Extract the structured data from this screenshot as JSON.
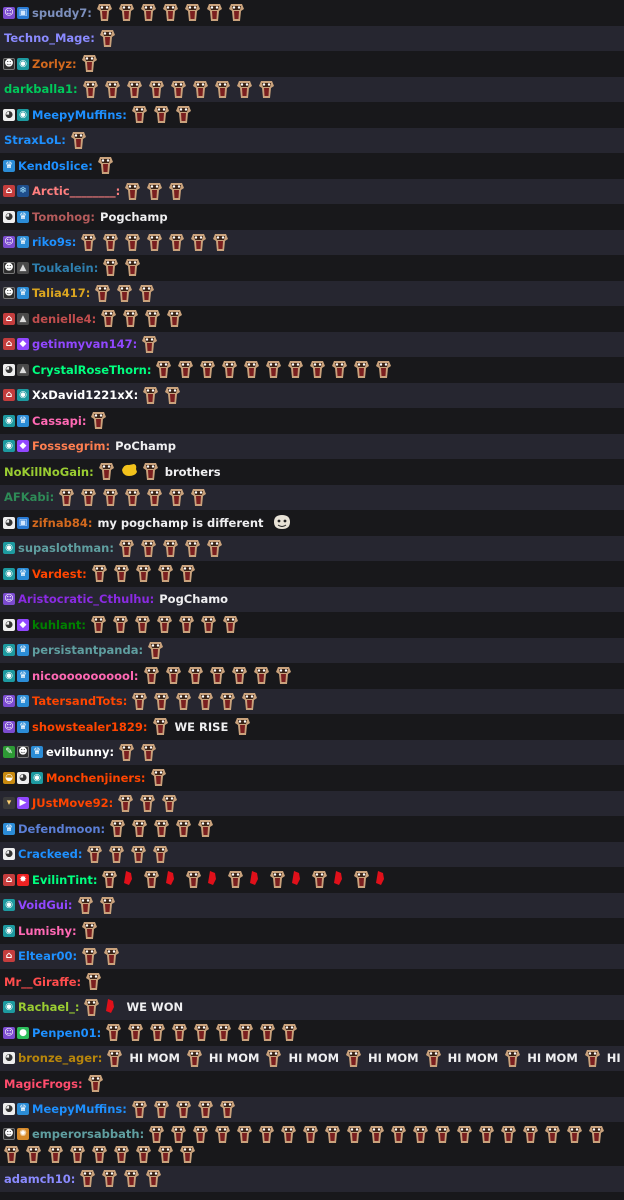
{
  "chat": [
    {
      "badges": [
        "sub",
        "gift"
      ],
      "user": "spuddy7",
      "color": "#7c8fbd",
      "parts": [
        {
          "e": "pog",
          "n": 7
        }
      ]
    },
    {
      "badges": [],
      "user": "Techno_Mage",
      "color": "#8a8aff",
      "parts": [
        {
          "e": "pog",
          "n": 1
        }
      ]
    },
    {
      "badges": [
        "mod",
        "teal"
      ],
      "user": "Zorlyz",
      "color": "#d2691e",
      "parts": [
        {
          "e": "pog",
          "n": 1
        }
      ]
    },
    {
      "badges": [],
      "user": "darkballa1",
      "color": "#00c85a",
      "parts": [
        {
          "e": "pog",
          "n": 9
        }
      ]
    },
    {
      "badges": [
        "cow",
        "teal"
      ],
      "user": "MeepyMuffins",
      "color": "#1e90ff",
      "parts": [
        {
          "e": "pog",
          "n": 3
        }
      ]
    },
    {
      "badges": [],
      "user": "StraxLoL",
      "color": "#1e90ff",
      "parts": [
        {
          "e": "pog",
          "n": 1
        }
      ]
    },
    {
      "badges": [
        "crown"
      ],
      "user": "Kend0slice",
      "color": "#1e90ff",
      "parts": [
        {
          "e": "pog",
          "n": 1
        }
      ]
    },
    {
      "badges": [
        "house",
        "snow"
      ],
      "user": "Arctic________",
      "color": "#ff7f7f",
      "parts": [
        {
          "e": "pog",
          "n": 3
        }
      ]
    },
    {
      "badges": [
        "cow",
        "crown"
      ],
      "user": "Tomohog",
      "color": "#b45b5b",
      "parts": [
        {
          "t": "Pogchamp"
        }
      ]
    },
    {
      "badges": [
        "sub",
        "crown"
      ],
      "user": "riko9s",
      "color": "#1e90ff",
      "parts": [
        {
          "e": "pog",
          "n": 7
        }
      ]
    },
    {
      "badges": [
        "mod",
        "tri"
      ],
      "user": "Toukalein",
      "color": "#2e7fae",
      "parts": [
        {
          "e": "pog",
          "n": 2
        }
      ]
    },
    {
      "badges": [
        "mod",
        "crown"
      ],
      "user": "Talia417",
      "color": "#daa520",
      "parts": [
        {
          "e": "pog",
          "n": 3
        }
      ]
    },
    {
      "badges": [
        "house",
        "tri"
      ],
      "user": "denielle4",
      "color": "#c04d4d",
      "parts": [
        {
          "e": "pog",
          "n": 4
        }
      ]
    },
    {
      "badges": [
        "house",
        "gem"
      ],
      "user": "getinmyvan147",
      "color": "#9147ff",
      "parts": [
        {
          "e": "pog",
          "n": 1
        }
      ]
    },
    {
      "badges": [
        "cow",
        "tri"
      ],
      "user": "CrystalRoseThorn",
      "color": "#00ff7f",
      "parts": [
        {
          "e": "pog",
          "n": 11
        }
      ]
    },
    {
      "badges": [
        "house",
        "teal"
      ],
      "user": "XxDavid1221xX",
      "color": "#ffffff",
      "parts": [
        {
          "e": "pog",
          "n": 2
        }
      ]
    },
    {
      "badges": [
        "teal",
        "crown"
      ],
      "user": "Cassapi",
      "color": "#ff69b4",
      "parts": [
        {
          "e": "pog",
          "n": 1
        }
      ]
    },
    {
      "badges": [
        "teal",
        "gem"
      ],
      "user": "Fosssegrim",
      "color": "#ff7f50",
      "parts": [
        {
          "t": "PoChamp"
        }
      ]
    },
    {
      "badges": [],
      "user": "NoKillNoGain",
      "color": "#9acd32",
      "parts": [
        {
          "e": "pog",
          "n": 1
        },
        {
          "e": "hand",
          "n": 1
        },
        {
          "e": "pog",
          "n": 1
        },
        {
          "t": "brothers"
        }
      ]
    },
    {
      "badges": [],
      "user": "AFKabi",
      "color": "#2e8b57",
      "parts": [
        {
          "e": "pog",
          "n": 7
        }
      ]
    },
    {
      "badges": [
        "cow",
        "gift"
      ],
      "user": "zifnab84",
      "color": "#d2691e",
      "parts": [
        {
          "t": "my pogchamp is different"
        },
        {
          "e": "face",
          "n": 1
        }
      ]
    },
    {
      "badges": [
        "teal"
      ],
      "user": "supaslothman",
      "color": "#5f9ea0",
      "parts": [
        {
          "e": "pog",
          "n": 5
        }
      ]
    },
    {
      "badges": [
        "teal",
        "crown"
      ],
      "user": "Vardest",
      "color": "#ff4500",
      "parts": [
        {
          "e": "pog",
          "n": 5
        }
      ]
    },
    {
      "badges": [
        "sub"
      ],
      "user": "Aristocratic_Cthulhu",
      "color": "#8a2be2",
      "parts": [
        {
          "t": "PogChamo"
        }
      ]
    },
    {
      "badges": [
        "cow",
        "gem"
      ],
      "user": "kuhlant",
      "color": "#008000",
      "parts": [
        {
          "e": "pog",
          "n": 7
        }
      ]
    },
    {
      "badges": [
        "teal",
        "crown"
      ],
      "user": "persistantpanda",
      "color": "#5f9ea0",
      "parts": [
        {
          "e": "pog",
          "n": 1
        }
      ]
    },
    {
      "badges": [
        "teal",
        "crown"
      ],
      "user": "nicooooooooool",
      "color": "#ff69b4",
      "parts": [
        {
          "e": "pog",
          "n": 7
        }
      ]
    },
    {
      "badges": [
        "sub",
        "crown"
      ],
      "user": "TatersandTots",
      "color": "#ff4500",
      "parts": [
        {
          "e": "pog",
          "n": 6
        }
      ]
    },
    {
      "badges": [
        "sub",
        "crown"
      ],
      "user": "showstealer1829",
      "color": "#ff4500",
      "parts": [
        {
          "e": "pog",
          "n": 1
        },
        {
          "t": "WE RISE"
        },
        {
          "e": "pog",
          "n": 1
        }
      ]
    },
    {
      "badges": [
        "wand",
        "mod",
        "crown"
      ],
      "user": "evilbunny",
      "color": "#ffffff",
      "parts": [
        {
          "e": "pog",
          "n": 2
        }
      ]
    },
    {
      "badges": [
        "sun",
        "cow",
        "teal"
      ],
      "user": "Monchenjiners",
      "color": "#ff4500",
      "parts": [
        {
          "e": "pog",
          "n": 1
        }
      ]
    },
    {
      "badges": [
        "dark",
        "vid"
      ],
      "user": "JUstMove92",
      "color": "#ff4500",
      "parts": [
        {
          "e": "pog",
          "n": 3
        }
      ]
    },
    {
      "badges": [
        "crown"
      ],
      "user": "Defendmoon",
      "color": "#5b7fd6",
      "parts": [
        {
          "e": "pog",
          "n": 5
        }
      ]
    },
    {
      "badges": [
        "cow"
      ],
      "user": "Crackeed",
      "color": "#1e90ff",
      "parts": [
        {
          "e": "pog",
          "n": 4
        }
      ]
    },
    {
      "badges": [
        "house",
        "star"
      ],
      "user": "EvilinTint",
      "color": "#00ff7f",
      "parts": [
        {
          "e": "pogred",
          "n": 7
        }
      ]
    },
    {
      "badges": [
        "teal"
      ],
      "user": "VoidGui",
      "color": "#9147ff",
      "parts": [
        {
          "e": "pog",
          "n": 2
        }
      ]
    },
    {
      "badges": [
        "teal"
      ],
      "user": "Lumishy",
      "color": "#ff69b4",
      "parts": [
        {
          "e": "pog",
          "n": 1
        }
      ]
    },
    {
      "badges": [
        "house"
      ],
      "user": "Eltear00",
      "color": "#1e90ff",
      "parts": [
        {
          "e": "pog",
          "n": 2
        }
      ]
    },
    {
      "badges": [],
      "user": "Mr__Giraffe",
      "color": "#ff4d4d",
      "parts": [
        {
          "e": "pog",
          "n": 1
        }
      ]
    },
    {
      "badges": [
        "teal"
      ],
      "user": "Rachael_",
      "color": "#9acd32",
      "parts": [
        {
          "e": "pogred",
          "n": 1
        },
        {
          "t": "WE WON"
        }
      ]
    },
    {
      "badges": [
        "sub",
        "green"
      ],
      "user": "Penpen01",
      "color": "#1e90ff",
      "parts": [
        {
          "e": "pog",
          "n": 9
        }
      ]
    },
    {
      "badges": [
        "cow"
      ],
      "user": "bronze_ager",
      "color": "#b8860b",
      "parts": [
        {
          "e": "pog",
          "n": 1
        },
        {
          "t": "HI MOM"
        },
        {
          "e": "pog",
          "n": 1
        },
        {
          "t": "HI MOM"
        },
        {
          "e": "pog",
          "n": 1
        },
        {
          "t": "HI MOM"
        },
        {
          "e": "pog",
          "n": 1
        },
        {
          "t": "HI MOM"
        },
        {
          "e": "pog",
          "n": 1
        },
        {
          "t": "HI MOM"
        },
        {
          "e": "pog",
          "n": 1
        },
        {
          "t": "HI MOM"
        },
        {
          "e": "pog",
          "n": 1
        },
        {
          "t": "HI MOM"
        }
      ]
    },
    {
      "badges": [],
      "user": "MagicFrogs",
      "color": "#ff4d6d",
      "parts": [
        {
          "e": "pog",
          "n": 1
        }
      ]
    },
    {
      "badges": [
        "cow",
        "crown"
      ],
      "user": "MeepyMuffins",
      "color": "#1e90ff",
      "parts": [
        {
          "e": "pog",
          "n": 5
        }
      ]
    },
    {
      "badges": [
        "mod",
        "cat"
      ],
      "user": "emperorsabbath",
      "color": "#5f9ea0",
      "tall": true,
      "parts": [
        {
          "e": "pog",
          "n": 30
        }
      ]
    },
    {
      "badges": [],
      "user": "adamch10",
      "color": "#8a8aff",
      "parts": [
        {
          "e": "pog",
          "n": 4
        }
      ]
    }
  ],
  "badge_glyphs": {
    "sub": "☺",
    "gift": "▣",
    "crown": "♛",
    "mod": "☻",
    "tri": "▲",
    "gem": "◆",
    "star": "✸",
    "green": "●",
    "teal": "◉",
    "cat": "✺",
    "cow": "◕",
    "dark": "▾",
    "wand": "✎",
    "house": "⌂",
    "sun": "◒",
    "vid": "▶",
    "snow": "❄"
  },
  "emote_names": {
    "pog": "pogchamp-emote",
    "pogred": "pogchamp-red-emote",
    "hand": "hand-emote",
    "face": "face-emote"
  }
}
